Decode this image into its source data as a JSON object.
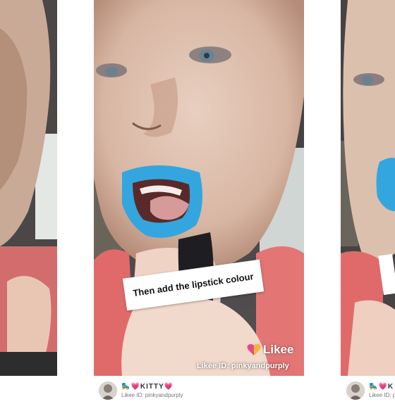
{
  "colors": {
    "lipstick": "#33a6e0",
    "likee_heart": "#e54b88",
    "shirt": "#ec6f87"
  },
  "center": {
    "sticker_text": "Then add the lipstick colour",
    "logo_icon": "heart-icon",
    "logo_text": "Likee",
    "likee_id": "Likee ID: pinkyandpurply"
  },
  "captions": {
    "center": {
      "name": "🛼💗KITTY💗",
      "id": "Likee ID: pinkyandpurply"
    },
    "right": {
      "name": "🛼💗K",
      "id": "Likee ID: pi"
    }
  }
}
